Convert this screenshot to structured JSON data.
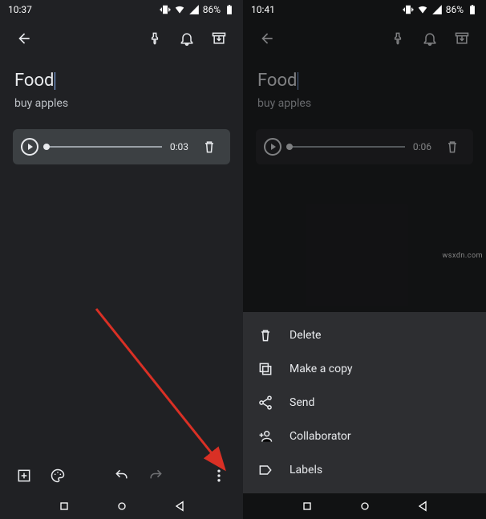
{
  "left": {
    "status": {
      "time": "10:37",
      "battery_pct": "86%"
    },
    "note": {
      "title": "Food",
      "body": "buy apples",
      "audio_duration": "0:03"
    }
  },
  "right": {
    "status": {
      "time": "10:41",
      "battery_pct": "86%"
    },
    "note": {
      "title": "Food",
      "body": "buy apples",
      "audio_duration": "0:06"
    },
    "menu": {
      "items": [
        {
          "label": "Delete"
        },
        {
          "label": "Make a copy"
        },
        {
          "label": "Send"
        },
        {
          "label": "Collaborator"
        },
        {
          "label": "Labels"
        }
      ]
    }
  },
  "watermark": "wsxdn.com"
}
